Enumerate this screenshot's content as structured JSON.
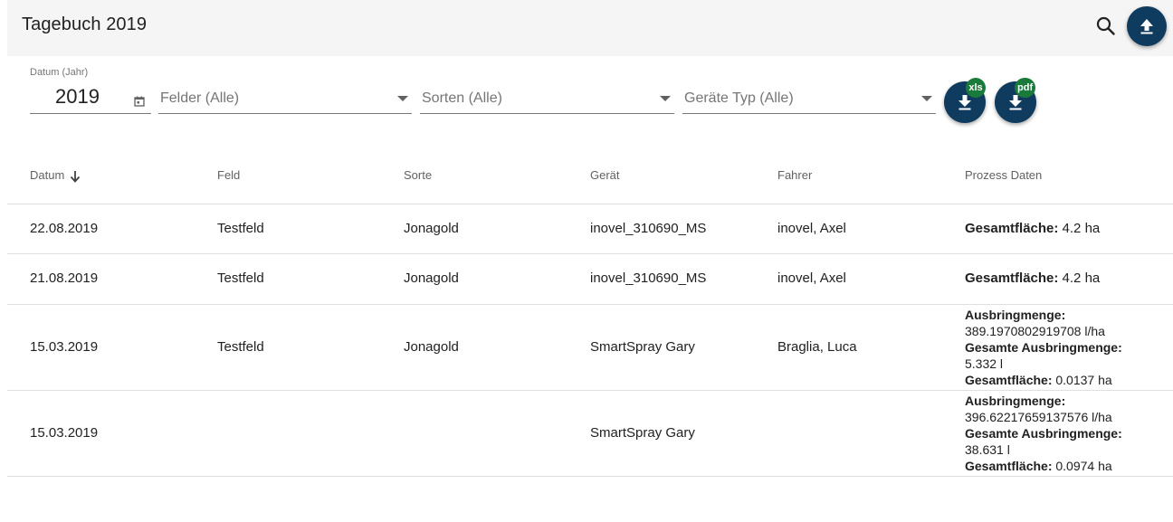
{
  "header": {
    "title": "Tagebuch 2019",
    "search_icon": "search-icon",
    "upload_icon": "upload-icon"
  },
  "filters": {
    "year_label": "Datum (Jahr)",
    "year_value": "2019",
    "fields_placeholder": "Felder (Alle)",
    "varieties_placeholder": "Sorten (Alle)",
    "device_type_placeholder": "Geräte Typ (Alle)",
    "xls_badge": "xls",
    "pdf_badge": "pdf"
  },
  "table": {
    "columns": [
      "Datum",
      "Feld",
      "Sorte",
      "Gerät",
      "Fahrer",
      "Prozess Daten"
    ],
    "rows": [
      {
        "date": "22.08.2019",
        "field": "Testfeld",
        "variety": "Jonagold",
        "device": "inovel_310690_MS",
        "driver": "inovel, Axel",
        "process": [
          {
            "label": "Gesamtfläche:",
            "value": "4.2 ha"
          }
        ]
      },
      {
        "date": "21.08.2019",
        "field": "Testfeld",
        "variety": "Jonagold",
        "device": "inovel_310690_MS",
        "driver": "inovel, Axel",
        "process": [
          {
            "label": "Gesamtfläche:",
            "value": "4.2 ha"
          }
        ]
      },
      {
        "date": "15.03.2019",
        "field": "Testfeld",
        "variety": "Jonagold",
        "device": "SmartSpray Gary",
        "driver": "Braglia, Luca",
        "process": [
          {
            "label": "Ausbringmenge:",
            "value": "389.1970802919708 l/ha"
          },
          {
            "label": "Gesamte Ausbringmenge:",
            "value": "5.332 l"
          },
          {
            "label": "Gesamtfläche:",
            "value": "0.0137 ha"
          }
        ]
      },
      {
        "date": "15.03.2019",
        "field": "",
        "variety": "",
        "device": "SmartSpray Gary",
        "driver": "",
        "process": [
          {
            "label": "Ausbringmenge:",
            "value": "396.62217659137576 l/ha"
          },
          {
            "label": "Gesamte Ausbringmenge:",
            "value": "38.631 l"
          },
          {
            "label": "Gesamtfläche:",
            "value": "0.0974 ha"
          }
        ]
      }
    ]
  },
  "colors": {
    "primary": "#0f3b5f",
    "badge": "#1a7a3a",
    "header_bg": "#f5f5f5"
  }
}
